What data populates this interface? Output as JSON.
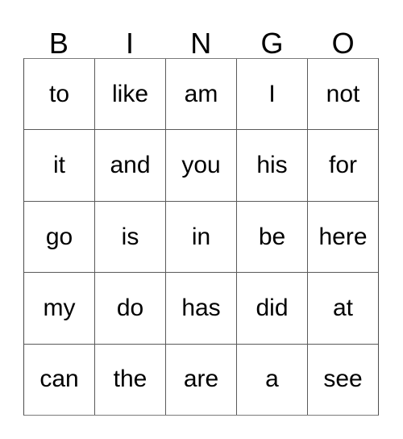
{
  "card": {
    "title": "BINGO",
    "columns": 5,
    "rows": 5,
    "colors": {
      "background": "#ffffff",
      "text": "#000000",
      "grid_line": "#5a5a5a",
      "outer_border": "#4d4d4d"
    }
  },
  "header": {
    "letters": [
      "B",
      "I",
      "N",
      "G",
      "O"
    ]
  },
  "grid": {
    "rows": [
      {
        "cells": [
          "to",
          "like",
          "am",
          "I",
          "not"
        ]
      },
      {
        "cells": [
          "it",
          "and",
          "you",
          "his",
          "for"
        ]
      },
      {
        "cells": [
          "go",
          "is",
          "in",
          "be",
          "here"
        ]
      },
      {
        "cells": [
          "my",
          "do",
          "has",
          "did",
          "at"
        ]
      },
      {
        "cells": [
          "can",
          "the",
          "are",
          "a",
          "see"
        ]
      }
    ]
  }
}
